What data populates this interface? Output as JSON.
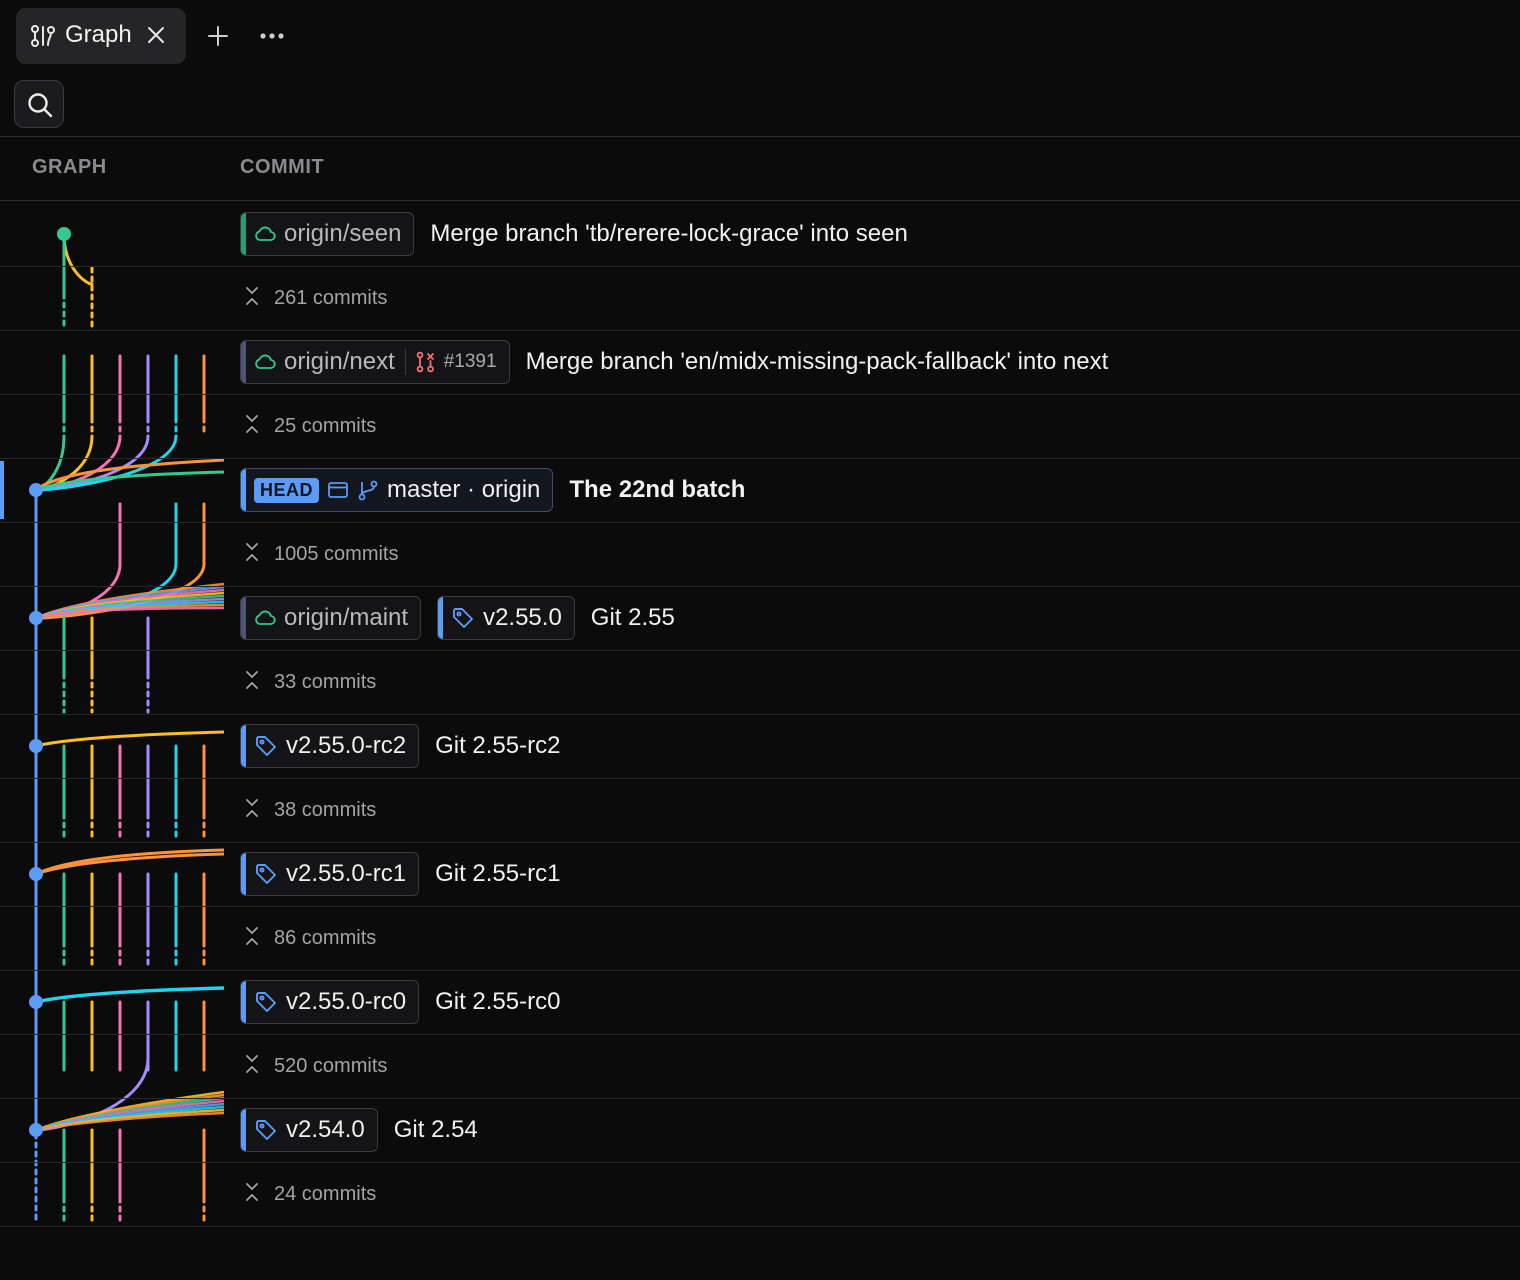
{
  "tabs": [
    {
      "label": "Graph",
      "icon": "git-graph-icon",
      "active": true
    }
  ],
  "toolbar": {
    "add_icon": "plus-icon",
    "more_icon": "more-horizontal-icon",
    "search_icon": "search-icon"
  },
  "columns": {
    "graph": "GRAPH",
    "commit": "COMMIT"
  },
  "colors": {
    "blue": "#5b9cf6",
    "green": "#34c98e",
    "yellow": "#fbbf24",
    "pink": "#f472b6",
    "purple": "#a78bfa",
    "cyan": "#22d3ee",
    "orange": "#fb923c",
    "remote_accent": "#4a5577",
    "seen_accent": "#2a9d6f"
  },
  "rows": [
    {
      "kind": "commit",
      "refs": [
        {
          "type": "remote",
          "icon": "cloud-icon",
          "label": "origin/seen",
          "accent": "#2a9d6f"
        }
      ],
      "message": "Merge branch 'tb/rerere-lock-grace' into seen"
    },
    {
      "kind": "collapsed",
      "icon": "expand-icon",
      "text": "261 commits"
    },
    {
      "kind": "commit",
      "refs": [
        {
          "type": "remote",
          "icon": "cloud-icon",
          "label": "origin/next",
          "accent": "#4a5577",
          "pr": "#1391",
          "pr_icon": "pull-request-icon"
        }
      ],
      "message": "Merge branch 'en/midx-missing-pack-fallback' into next"
    },
    {
      "kind": "collapsed",
      "icon": "expand-icon",
      "text": "25 commits"
    },
    {
      "kind": "commit",
      "head": true,
      "refs": [
        {
          "type": "head",
          "badge": "HEAD",
          "icon": "window-icon",
          "icon2": "branch-icon",
          "label": "master · origin",
          "accent": "#5b9cf6"
        }
      ],
      "message": "The 22nd batch",
      "bold": true
    },
    {
      "kind": "collapsed",
      "icon": "expand-icon",
      "text": "1005 commits"
    },
    {
      "kind": "commit",
      "refs": [
        {
          "type": "remote",
          "icon": "cloud-icon",
          "label": "origin/maint",
          "accent": "#4a5577"
        },
        {
          "type": "tag",
          "icon": "tag-icon",
          "label": "v2.55.0",
          "accent": "#5b9cf6"
        }
      ],
      "message": "Git 2.55"
    },
    {
      "kind": "collapsed",
      "icon": "expand-icon",
      "text": "33 commits"
    },
    {
      "kind": "commit",
      "refs": [
        {
          "type": "tag",
          "icon": "tag-icon",
          "label": "v2.55.0-rc2",
          "accent": "#5b9cf6"
        }
      ],
      "message": "Git 2.55-rc2"
    },
    {
      "kind": "collapsed",
      "icon": "expand-icon",
      "text": "38 commits"
    },
    {
      "kind": "commit",
      "refs": [
        {
          "type": "tag",
          "icon": "tag-icon",
          "label": "v2.55.0-rc1",
          "accent": "#5b9cf6"
        }
      ],
      "message": "Git 2.55-rc1"
    },
    {
      "kind": "collapsed",
      "icon": "expand-icon",
      "text": "86 commits"
    },
    {
      "kind": "commit",
      "refs": [
        {
          "type": "tag",
          "icon": "tag-icon",
          "label": "v2.55.0-rc0",
          "accent": "#5b9cf6"
        }
      ],
      "message": "Git 2.55-rc0"
    },
    {
      "kind": "collapsed",
      "icon": "expand-icon",
      "text": "520 commits"
    },
    {
      "kind": "commit",
      "refs": [
        {
          "type": "tag",
          "icon": "tag-icon",
          "label": "v2.54.0",
          "accent": "#5b9cf6"
        }
      ],
      "message": "Git 2.54"
    },
    {
      "kind": "collapsed",
      "icon": "expand-icon",
      "text": "24 commits"
    }
  ]
}
